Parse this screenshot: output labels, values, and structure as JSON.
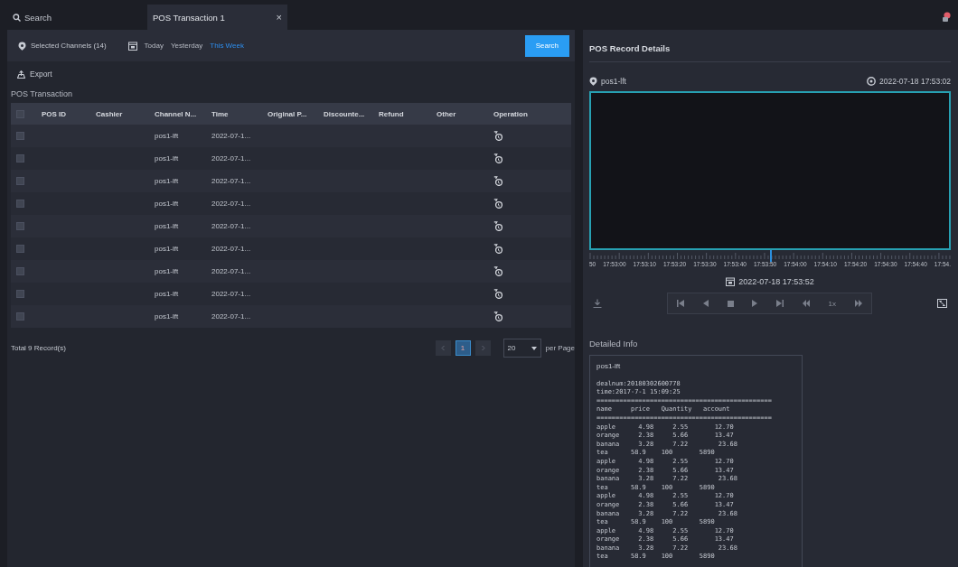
{
  "tabs": [
    {
      "kind": "search",
      "label": "Search",
      "selected": false
    },
    {
      "kind": "page",
      "label": "POS Transaction 1",
      "selected": true,
      "close": "×"
    }
  ],
  "filter": {
    "channels": "Selected Channels (14)",
    "dates": [
      {
        "label": "Today",
        "selected": false
      },
      {
        "label": "Yesterday",
        "selected": false
      },
      {
        "label": "This Week",
        "selected": true
      }
    ],
    "search_button": "Search"
  },
  "export": "Export",
  "table": {
    "title": "POS Transaction",
    "header_checked": false,
    "columns": [
      "POS ID",
      "Cashier",
      "Channel N...",
      "Time",
      "Original P...",
      "Discounte...",
      "Refund",
      "Other",
      "Operation"
    ],
    "rows": [
      {
        "checked": false,
        "channel": "pos1-lft",
        "time": "2022-07-1..."
      },
      {
        "checked": false,
        "channel": "pos1-lft",
        "time": "2022-07-1..."
      },
      {
        "checked": false,
        "channel": "pos1-lft",
        "time": "2022-07-1..."
      },
      {
        "checked": false,
        "channel": "pos1-lft",
        "time": "2022-07-1..."
      },
      {
        "checked": false,
        "channel": "pos1-lft",
        "time": "2022-07-1..."
      },
      {
        "checked": false,
        "channel": "pos1-lft",
        "time": "2022-07-1..."
      },
      {
        "checked": false,
        "channel": "pos1-lft",
        "time": "2022-07-1..."
      },
      {
        "checked": false,
        "channel": "pos1-lft",
        "time": "2022-07-1..."
      },
      {
        "checked": false,
        "channel": "pos1-lft",
        "time": "2022-07-1..."
      }
    ]
  },
  "footer": {
    "total": "Total 9 Record(s)",
    "pages": [
      {
        "label": "1",
        "selected": true
      }
    ],
    "page_size": "20",
    "per_page": "per Page"
  },
  "details": {
    "title": "POS Record Details",
    "channel": "pos1-lft",
    "time": "2022-07-18 17:53:02",
    "timeline": {
      "labels": [
        "50",
        "17:53:00",
        "17:53:10",
        "17:53:20",
        "17:53:30",
        "17:53:40",
        "17:53:50",
        "17:54:00",
        "17:54:10",
        "17:54:20",
        "17:54:30",
        "17:54:40",
        "17:54."
      ],
      "cursor": {
        "level": 0.5
      },
      "date": "2022-07-18 17:53:52"
    },
    "speed": "1x",
    "info_title": "Detailed Info",
    "receipt": [
      "pos1-lft",
      "dealnum:20180302600778",
      "time:2017-7-1 15:09:25",
      "==============================================",
      "name     price   Quantity   account",
      "==============================================",
      "apple      4.98     2.55       12.70",
      "orange     2.38     5.66       13.47",
      "banana     3.28     7.22        23.68",
      "tea      58.9    100       5890",
      "apple      4.98     2.55       12.70",
      "orange     2.38     5.66       13.47",
      "banana     3.28     7.22        23.68",
      "tea      58.9    100       5890",
      "apple      4.98     2.55       12.70",
      "orange     2.38     5.66       13.47",
      "banana     3.28     7.22        23.68",
      "tea      58.9    100       5890",
      "apple      4.98     2.55       12.70",
      "orange     2.38     5.66       13.47",
      "banana     3.28     7.22        23.68",
      "tea      58.9    100       5890"
    ]
  }
}
